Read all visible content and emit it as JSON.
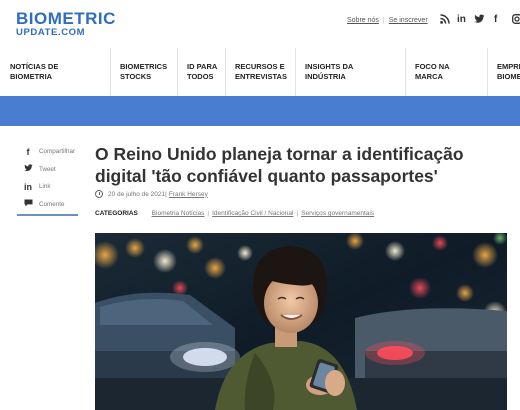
{
  "brand": {
    "line1": "BIOMETRIC",
    "line2": "UPDATE.COM"
  },
  "toplinks": {
    "about": "Sobre nós",
    "separator": "|",
    "subscribe": "Se inscrever"
  },
  "social": {
    "rss": "rss-icon",
    "linkedin": "in",
    "twitter": "twitter-icon",
    "facebook": "f"
  },
  "nav": [
    {
      "label": "NOTÍCIAS DE BIOMETRIA"
    },
    {
      "label": "BIOMETRICS STOCKS"
    },
    {
      "label": "ID PARA TODOS"
    },
    {
      "label": "RECURSOS E ENTREVISTAS"
    },
    {
      "label": "INSIGHTS DA INDÚSTRIA"
    },
    {
      "label": "FOCO NA MARCA"
    },
    {
      "label": "EMPRE BIOME"
    }
  ],
  "share": [
    {
      "icon": "facebook-icon",
      "glyph": "f",
      "label": "Compartilhar"
    },
    {
      "icon": "twitter-icon",
      "glyph": "🐦",
      "label": "Tweet"
    },
    {
      "icon": "linkedin-icon",
      "glyph": "in",
      "label": "Link"
    },
    {
      "icon": "comment-icon",
      "glyph": "💬",
      "label": "Comente"
    }
  ],
  "article": {
    "title_line1": "O Reino Unido planeja tornar a identificação",
    "title_line2": "digital 'tão confiável quanto passaportes'",
    "date": "20 de julho de 2021",
    "meta_separator": "|",
    "author": "Frank Hersey",
    "categories_label": "CATEGORIAS",
    "categories": [
      "Biometria Notícias",
      "Identificação Civil / Nacional",
      "Serviços governamentais"
    ]
  }
}
